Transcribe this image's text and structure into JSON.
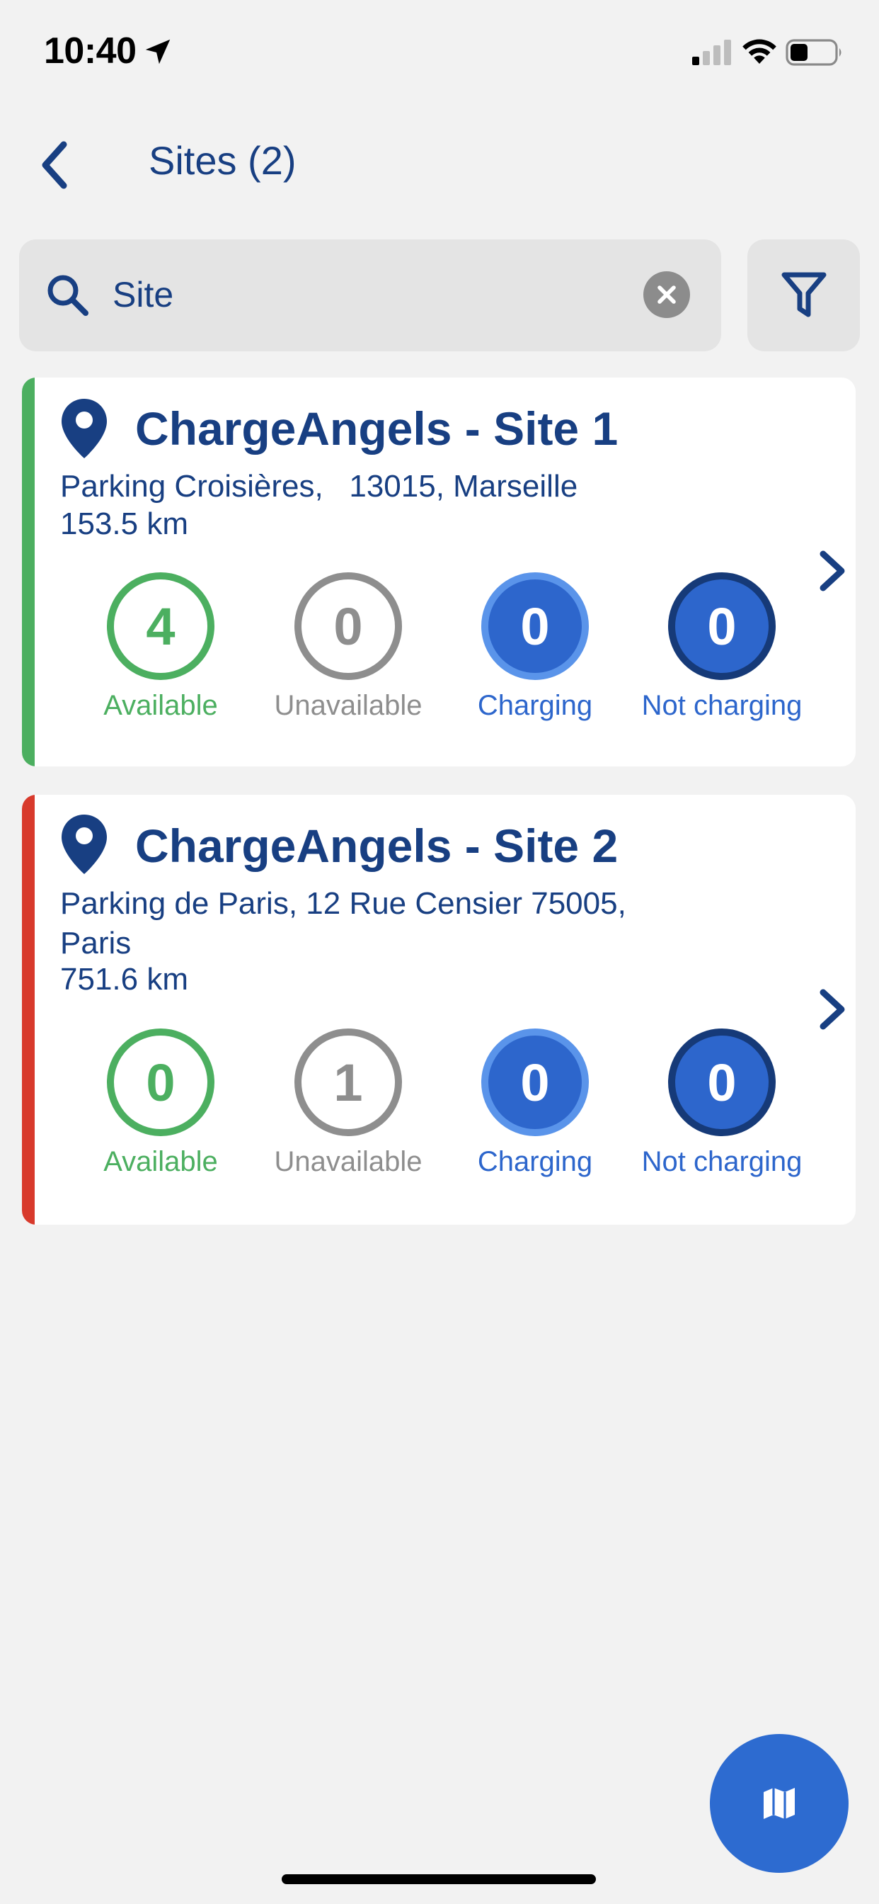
{
  "status_bar": {
    "time": "10:40"
  },
  "nav": {
    "title": "Sites (2)"
  },
  "search": {
    "value": "Site"
  },
  "colors": {
    "primary": "#183f82",
    "available": "#4caf60",
    "unavailable": "#8e8e8e",
    "charging": "#2d66cc",
    "site1_accent": "#4caf60",
    "site2_accent": "#d83a2c",
    "fab": "#2d6bd0"
  },
  "sites": [
    {
      "name": "ChargeAngels - Site 1",
      "address": "Parking Croisières,   13015, Marseille",
      "distance": "153.5 km",
      "stats": [
        {
          "count": "4",
          "label": "Available"
        },
        {
          "count": "0",
          "label": "Unavailable"
        },
        {
          "count": "0",
          "label": "Charging"
        },
        {
          "count": "0",
          "label": "Not charging"
        }
      ]
    },
    {
      "name": "ChargeAngels - Site 2",
      "address": "Parking de Paris, 12 Rue Censier 75005,\nParis",
      "distance": "751.6 km",
      "stats": [
        {
          "count": "0",
          "label": "Available"
        },
        {
          "count": "1",
          "label": "Unavailable"
        },
        {
          "count": "0",
          "label": "Charging"
        },
        {
          "count": "0",
          "label": "Not charging"
        }
      ]
    }
  ],
  "icons": {
    "back": "chevron-left-icon",
    "search": "magnifier-icon",
    "clear": "clear-x-icon",
    "filter": "funnel-icon",
    "pin": "location-pin-icon",
    "row_chevron": "chevron-right-icon",
    "map": "map-icon"
  }
}
